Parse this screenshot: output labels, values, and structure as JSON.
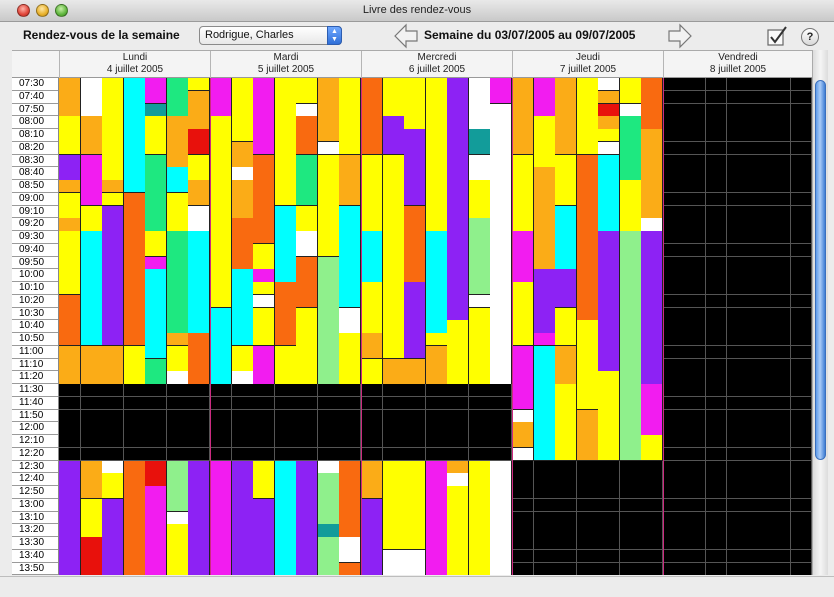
{
  "window": {
    "title": "Livre des rendez-vous"
  },
  "toolbar": {
    "week_label": "Rendez-vous de la semaine",
    "person_select": "Rodrigue, Charles",
    "week_range": "Semaine du 03/07/2005 au 09/07/2005",
    "help_label": "?"
  },
  "days": [
    {
      "name": "Lundi",
      "date": "4 juillet 2005"
    },
    {
      "name": "Mardi",
      "date": "5 juillet 2005"
    },
    {
      "name": "Mercredi",
      "date": "6 juillet 2005"
    },
    {
      "name": "Jeudi",
      "date": "7 juillet 2005"
    },
    {
      "name": "Vendredi",
      "date": "8 juillet 2005"
    }
  ],
  "times": [
    "07:30",
    "07:40",
    "07:50",
    "08:00",
    "08:10",
    "08:20",
    "08:30",
    "08:40",
    "08:50",
    "09:00",
    "09:10",
    "09:20",
    "09:30",
    "09:40",
    "09:50",
    "10:00",
    "10:10",
    "10:20",
    "10:30",
    "10:40",
    "10:50",
    "11:00",
    "11:10",
    "11:20",
    "11:30",
    "11:40",
    "11:50",
    "12:00",
    "12:10",
    "12:20",
    "12:30",
    "12:40",
    "12:50",
    "13:00",
    "13:10",
    "13:20",
    "13:30",
    "13:40",
    "13:50"
  ],
  "palette": {
    "Y": "#ffff00",
    "O": "#fbac17",
    "R": "#f96a10",
    "C": "#00ffff",
    "G": "#1ee880",
    "M": "#f21cf0",
    "P": "#8d22f4",
    "L": "#8ff08c",
    "W": "#ffffff",
    "K": "#000000",
    "D": "#e8110c",
    "T": "#129c9a"
  },
  "schedule": [
    [
      "OWYCMGY",
      "OWYCMGO",
      "OWYCTGO",
      "YOYCYOO",
      "YOYCYOD",
      "YOYCYOD",
      "PMYCGOY",
      "PMYCGCY",
      "OMOCGCO",
      "YMYRGYO",
      "YYPRGYW",
      "OYPRGYW",
      "YCPRYGC",
      "YCPRYGC",
      "YCPRMGC",
      "YCPRCGC",
      "YCPRCGC",
      "RCPRCGC",
      "RCPRCGC",
      "RCPRCGC",
      "RCPRCOR",
      "OOOYCYR",
      "OOOYGYR",
      "OOOYGWR",
      "KKKKKKK",
      "KKKKKKK",
      "KKKKKKK",
      "KKKKKKK",
      "KKKKKKK",
      "KKKKKKK",
      "POWRDLP",
      "POYRDLP",
      "POYRMLP",
      "PYPRMLP",
      "PYPRMWP",
      "PYPRMYP",
      "PDPRMYP",
      "PDPRMYP",
      "PDPRMYP"
    ],
    [
      "MYMYYOY",
      "MYMYYOY",
      "MYMYWOY",
      "YYMYROY",
      "YYMYROY",
      "YOMYRWY",
      "YORYGYO",
      "YWRYGYO",
      "YORYGYO",
      "YORYGYO",
      "YORCYYC",
      "YRRCYYC",
      "YRRCWYC",
      "YRYCWYC",
      "YRYCRLC",
      "YCMCRLC",
      "YCYRRLC",
      "YCWRRLC",
      "CCYRYLW",
      "CCYRYLW",
      "CCYRYLY",
      "CYMYYLY",
      "CYMYYLY",
      "CWMYYLY",
      "KKKKKKK",
      "KKKKKKK",
      "KKKKKKK",
      "KKKKKKK",
      "KKKKKKK",
      "KKKKKKK",
      "MPYCPWR",
      "MPYCPLR",
      "MPYCPLR",
      "MPPCPLR",
      "MPPCPLR",
      "MPPCPTR",
      "MPPCPLW",
      "MPPCPLW",
      "MPPCPLR"
    ],
    [
      "RYYYPWM",
      "RYYYPWM",
      "RYYYPWW",
      "RPYYPWW",
      "RPPYPTW",
      "RPPYPTW",
      "YYPYPWW",
      "YYPYPWW",
      "YYPYPYW",
      "YYPYPYW",
      "YYRYPYW",
      "YYRYPLW",
      "CYRCPLW",
      "CYRCPLW",
      "CYRCPLW",
      "CYRCPLW",
      "YYPCPLW",
      "YYPCPWW",
      "YYPCPYW",
      "YYPCYYW",
      "OYPYYYW",
      "OYPOYYW",
      "YOOOYYW",
      "YOOOYYW",
      "KKKKKKK",
      "KKKKKKK",
      "KKKKKKK",
      "KKKKKKK",
      "KKKKKKK",
      "KKKKKKK",
      "OYYMOYW",
      "OYYMWYW",
      "OYYMYYW",
      "PYYMYYW",
      "PYYMYYW",
      "PYYMYYW",
      "PYYMYYW",
      "PWWMYYW",
      "PWWMYYW"
    ],
    [
      "OMOYWYR",
      "OMOYOYR",
      "OMOYDWR",
      "OYOYOGR",
      "OYOYYGO",
      "OYOYWGO",
      "YYYRCGO",
      "YOYRCGO",
      "YOYRCYO",
      "YOYRCYO",
      "YOCRCYO",
      "YOCRCYW",
      "MOCRPLP",
      "MOCRPLP",
      "MOCRPLP",
      "MPPRPLP",
      "YPPRPLP",
      "YPPRPLP",
      "YPYRPLP",
      "YPYYPLP",
      "YMYYPLP",
      "MCOYPLP",
      "MCOYPLP",
      "MCOYYLP",
      "MCYYYLM",
      "MCYYYLM",
      "WCYOYLM",
      "OCYOYLM",
      "OCYOYLY",
      "WCYOYLY",
      "KKKKKKK",
      "KKKKKKK",
      "KKKKKKK",
      "KKKKKKK",
      "KKKKKKK",
      "KKKKKKK",
      "KKKKKKK",
      "KKKKKKK",
      "KKKKKKK"
    ],
    [
      "KKKKKKK",
      "KKKKKKK",
      "KKKKKKK",
      "KKKKKKK",
      "KKKKKKK",
      "KKKKKKK",
      "KKKKKKK",
      "KKKKKKK",
      "KKKKKKK",
      "KKKKKKK",
      "KKKKKKK",
      "KKKKKKK",
      "KKKKKKK",
      "KKKKKKK",
      "KKKKKKK",
      "KKKKKKK",
      "KKKKKKK",
      "KKKKKKK",
      "KKKKKKK",
      "KKKKKKK",
      "KKKKKKK",
      "KKKKKKK",
      "KKKKKKK",
      "KKKKKKK",
      "KKKKKKK",
      "KKKKKKK",
      "KKKKKKK",
      "KKKKKKK",
      "KKKKKKK",
      "KKKKKKK",
      "KKKKKKK",
      "KKKKKKK",
      "KKKKKKK",
      "KKKKKKK",
      "KKKKKKK",
      "KKKKKKK",
      "KKKKKKK",
      "KKKKKKK",
      "KKKKKKK"
    ]
  ]
}
